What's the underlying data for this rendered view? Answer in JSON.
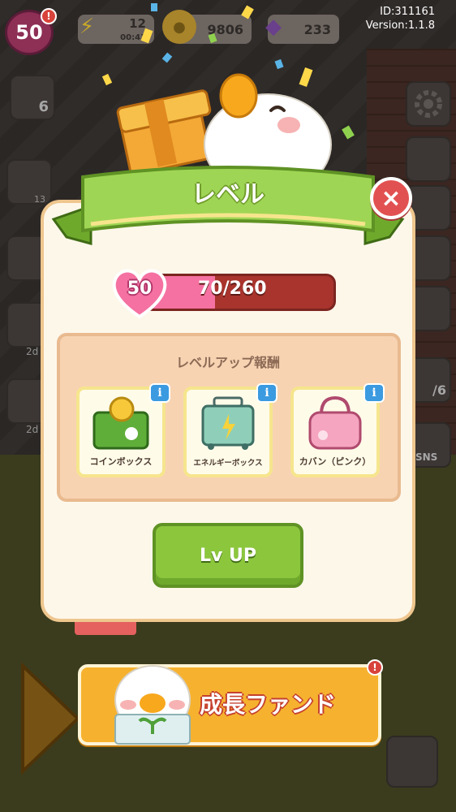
{
  "hud": {
    "player_level": "50",
    "energy": "12",
    "energy_timer": "00:41",
    "coins": "9806",
    "gems": "233",
    "id": "ID:311161",
    "version": "Version:1.1.8",
    "alert": "!"
  },
  "side_labels": {
    "left_quest_count": "6",
    "left_timer_1": "13",
    "left_timer_2": "2d",
    "left_timer_3": "2d",
    "right_count": "/6",
    "right_sns": "SNS"
  },
  "dialog": {
    "title": "レベル",
    "close_icon": "×",
    "level": "50",
    "xp_current": 70,
    "xp_max": 260,
    "xp_text": "70/260",
    "rewards_title": "レベルアップ報酬",
    "rewards": [
      {
        "label": "コインボックス",
        "icon": "coin-box-icon"
      },
      {
        "label": "エネルギーボックス",
        "icon": "energy-box-icon"
      },
      {
        "label": "カバン（ピンク）",
        "icon": "pink-bag-icon"
      }
    ],
    "info_label": "i",
    "lvup_label": "Lv UP"
  },
  "fund": {
    "label": "成長ファンド",
    "alert": "!"
  },
  "colors": {
    "xp_fill": "#f571a1",
    "xp_track": "#a8342d",
    "button_green": "#8cc63d",
    "banner_green": "#9fd554",
    "close_red": "#e25151",
    "info_blue": "#3b9ae0",
    "fund_orange": "#f6b22f"
  }
}
